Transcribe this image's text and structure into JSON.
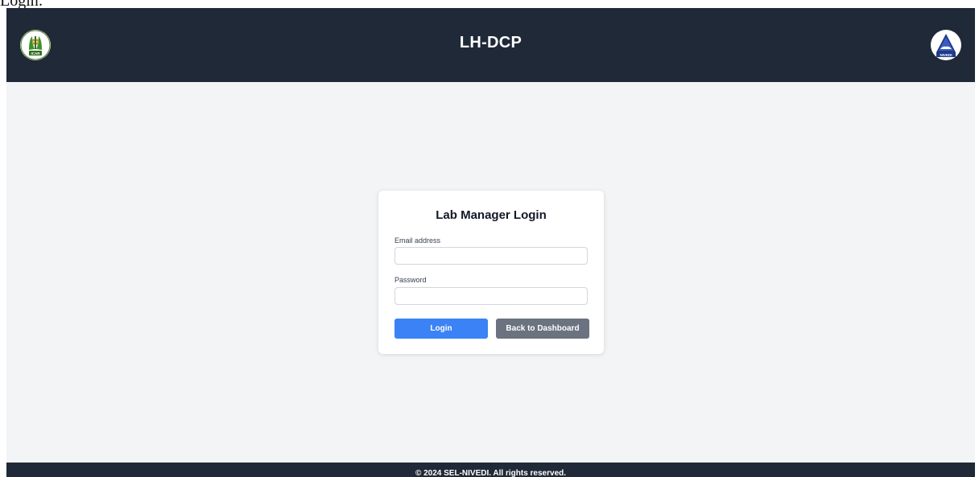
{
  "caption": "Login:",
  "header": {
    "title": "LH-DCP",
    "left_logo": {
      "icon": "icar-logo-icon",
      "text": "ICAR"
    },
    "right_logo": {
      "icon": "nivedi-logo-icon",
      "text": "NIVEDI"
    }
  },
  "login_card": {
    "title": "Lab Manager Login",
    "email_label": "Email address",
    "email_value": "",
    "password_label": "Password",
    "password_value": "",
    "login_button": "Login",
    "back_button": "Back to Dashboard"
  },
  "footer": {
    "text": "© 2024 SEL-NIVEDI. All rights reserved."
  },
  "colors": {
    "header_bg": "#1f2937",
    "page_bg": "#f3f4f6",
    "primary": "#3b82f6",
    "secondary": "#6b7280"
  }
}
